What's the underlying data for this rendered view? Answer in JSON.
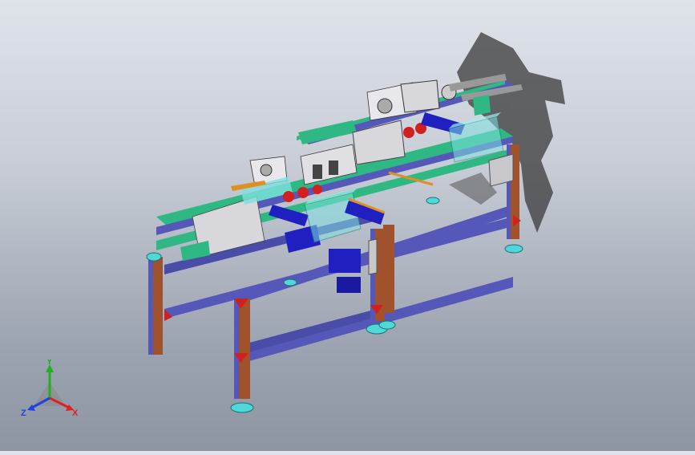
{
  "viewport": {
    "background_top": "#dfe3ea",
    "background_bottom": "#8e95a2"
  },
  "triad": {
    "x_label": "X",
    "y_label": "Y",
    "z_label": "Z",
    "x_color": "#e02020",
    "y_color": "#20b020",
    "z_color": "#2040e0"
  },
  "colors": {
    "extrusion_blue": "#5558b8",
    "extrusion_green": "#2fb884",
    "leg_brown": "#a0522d",
    "bracket_red": "#d02020",
    "motor_blue": "#2020c0",
    "guard_glass": "#7fe0e0",
    "foot_cyan": "#4fd8d8",
    "shadow": "#3a3a3a"
  }
}
